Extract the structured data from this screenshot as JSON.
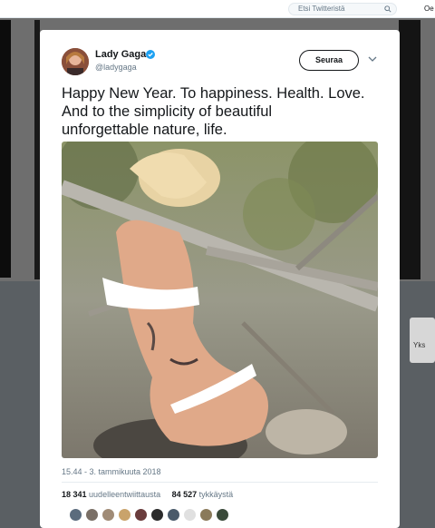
{
  "topbar": {
    "search_placeholder": "Etsi Twitteristä",
    "right_text": "Oe"
  },
  "side_card": {
    "text": "Yks"
  },
  "tweet": {
    "display_name": "Lady Gaga",
    "handle": "@ladygaga",
    "follow_label": "Seuraa",
    "text_lines": [
      "Happy New Year. To happiness. Health. Love.",
      "And to the simplicity of beautiful",
      "unforgettable nature, life."
    ],
    "timestamp": "15.44 - 3. tammikuuta 2018",
    "retweets": {
      "count": "18 341",
      "label": "uudelleentwiittausta"
    },
    "likes": {
      "count": "84 527",
      "label": "tykkäystä"
    },
    "liker_avatars": [
      "#5b6c7d",
      "#7a6f66",
      "#a08b76",
      "#c9a36b",
      "#6a3c3c",
      "#2b2b2b",
      "#4a5a6a",
      "#e0e0e0",
      "#8a7a5a",
      "#3a4a3a"
    ]
  },
  "icons": {
    "search": "search-icon",
    "verified": "verified-badge-icon",
    "chevron": "chevron-down-icon"
  },
  "colors": {
    "verified": "#1da1f2",
    "text": "#14171a",
    "muted": "#657786"
  }
}
